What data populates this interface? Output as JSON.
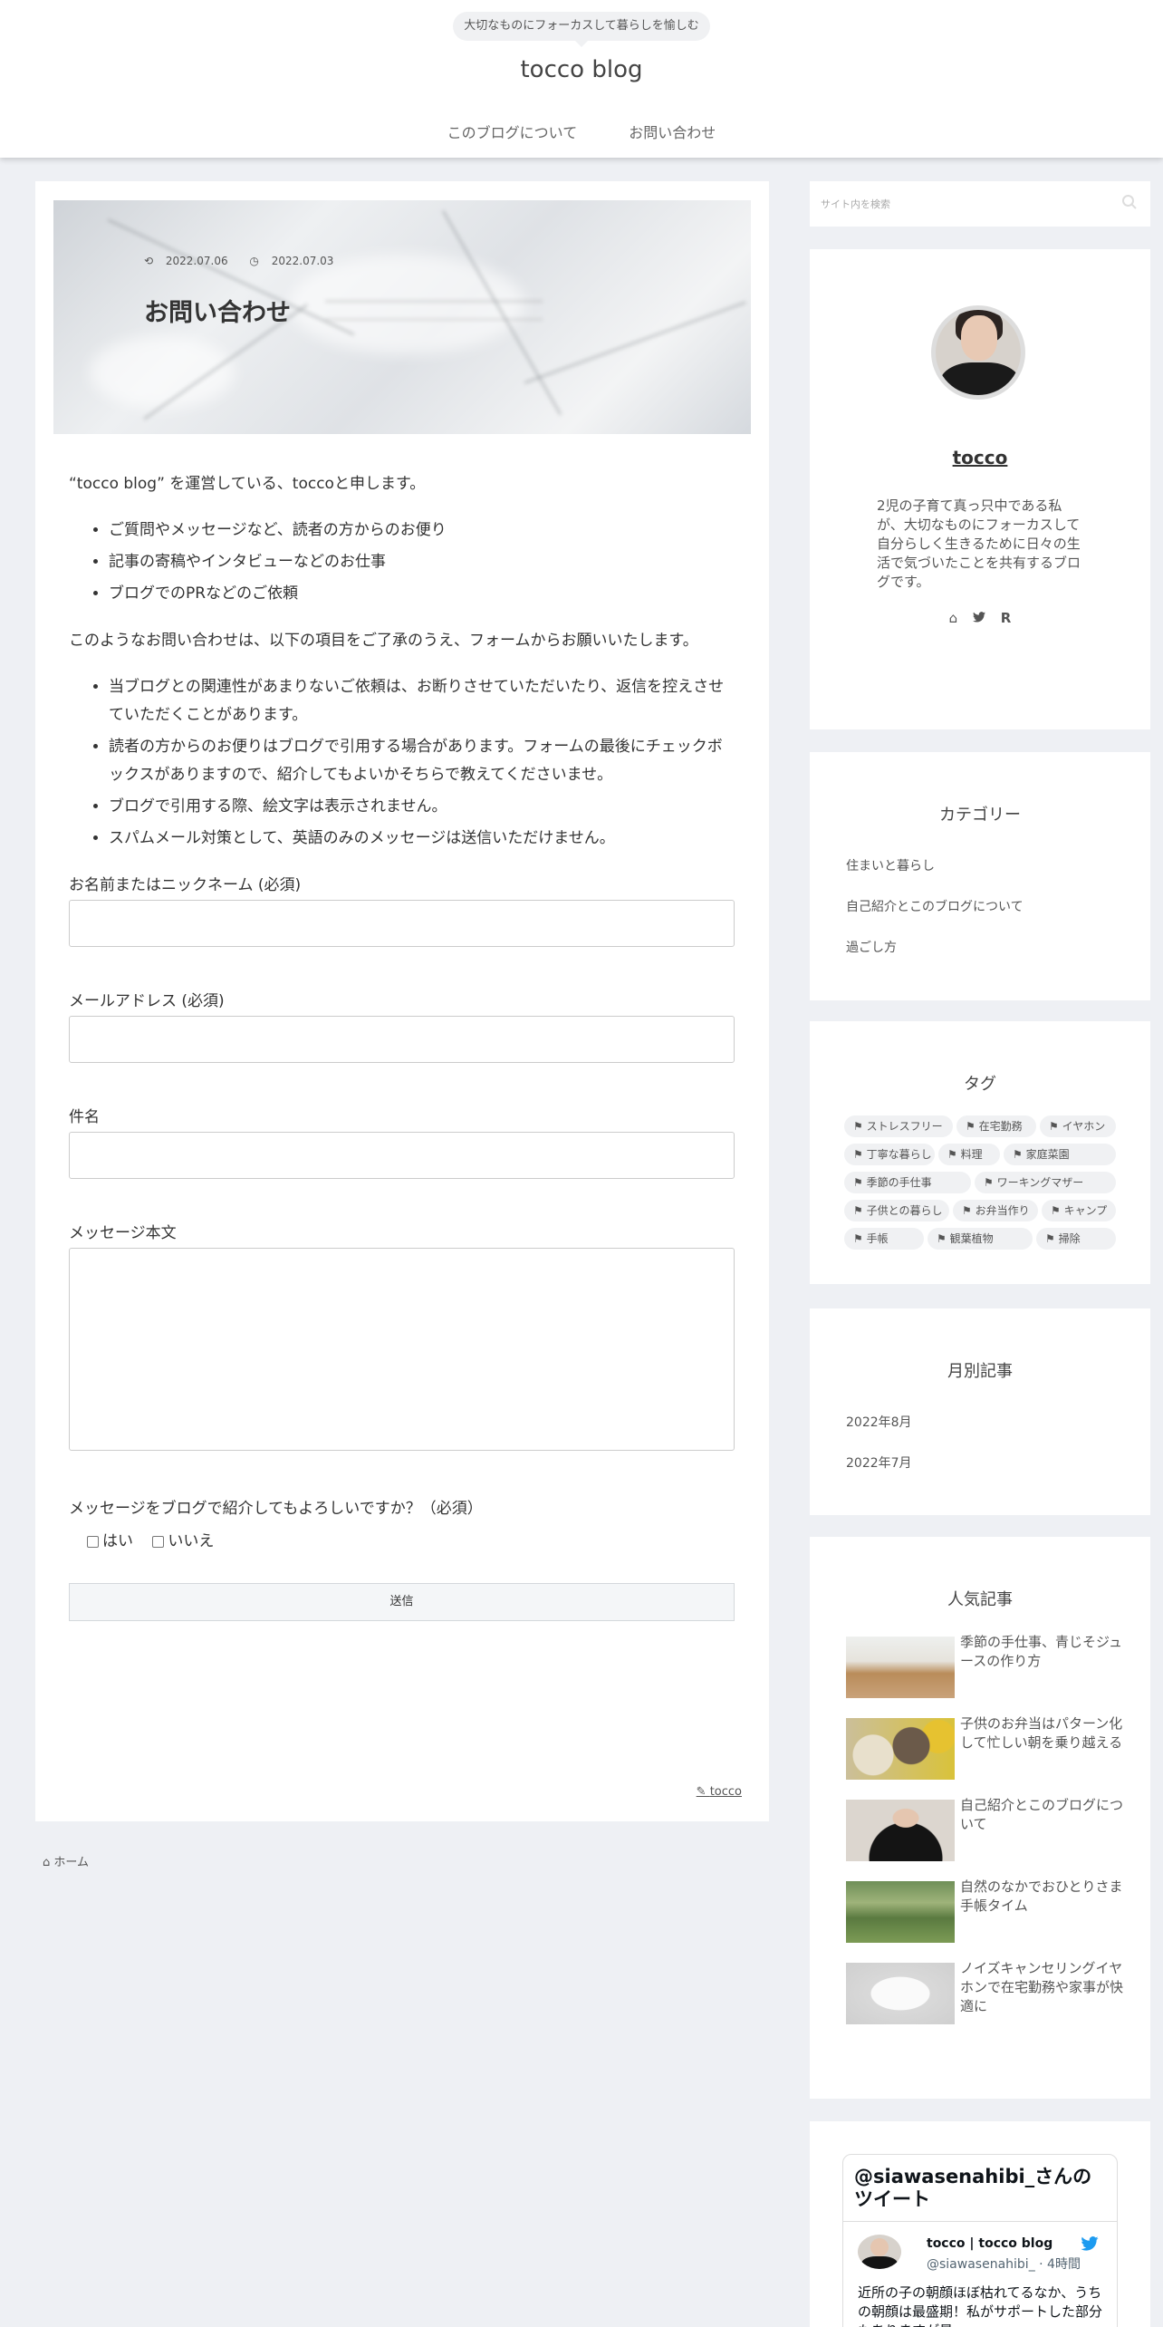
{
  "header": {
    "tagline": "大切なものにフォーカスして暮らしを愉しむ",
    "site_title": "tocco blog",
    "nav": [
      "このブログについて",
      "お問い合わせ"
    ]
  },
  "article": {
    "date_updated": "2022.07.06",
    "date_published": "2022.07.03",
    "title": "お問い合わせ",
    "intro": "“tocco blog” を運営している、toccoと申します。",
    "list1": [
      "ご質問やメッセージなど、読者の方からのお便り",
      "記事の寄稿やインタビューなどのお仕事",
      "ブログでのPRなどのご依頼"
    ],
    "para2": "このようなお問い合わせは、以下の項目をご了承のうえ、フォームからお願いいたします。",
    "list2": [
      "当ブログとの関連性があまりないご依頼は、お断りさせていただいたり、返信を控えさせていただくことがあります。",
      "読者の方からのお便りはブログで引用する場合があります。フォームの最後にチェックボックスがありますので、紹介してもよいかそちらで教えてくださいませ。",
      "ブログで引用する際、絵文字は表示されません。",
      "スパムメール対策として、英語のみのメッセージは送信いただけません。"
    ],
    "form": {
      "name_label": "お名前またはニックネーム (必須)",
      "email_label": "メールアドレス (必須)",
      "subject_label": "件名",
      "message_label": "メッセージ本文",
      "consent_label": "メッセージをブログで紹介してもよろしいですか？（必須）",
      "yes": "はい",
      "no": "いいえ",
      "submit": "送信"
    },
    "author": "tocco"
  },
  "breadcrumb": "ホーム",
  "sidebar": {
    "search_placeholder": "サイト内を検索",
    "profile": {
      "name": "tocco",
      "description": "2児の子育て真っ只中である私が、大切なものにフォーカスして自分らしく生きるために日々の生活で気づいたことを共有するブログです。"
    },
    "categories": {
      "title": "カテゴリー",
      "items": [
        "住まいと暮らし",
        "自己紹介とこのブログについて",
        "過ごし方"
      ]
    },
    "tags": {
      "title": "タグ",
      "items": [
        "ストレスフリー",
        "在宅勤務",
        "イヤホン",
        "丁寧な暮らし",
        "料理",
        "家庭菜園",
        "季節の手仕事",
        "ワーキングマザー",
        "子供との暮らし",
        "お弁当作り",
        "キャンプ",
        "手帳",
        "観葉植物",
        "掃除"
      ]
    },
    "archives": {
      "title": "月別記事",
      "items": [
        "2022年8月",
        "2022年7月"
      ]
    },
    "popular": {
      "title": "人気記事",
      "items": [
        "季節の手仕事、青じそジュースの作り方",
        "子供のお弁当はパターン化して忙しい朝を乗り越える",
        "自己紹介とこのブログについて",
        "自然のなかでおひとりさま手帳タイム",
        "ノイズキャンセリングイヤホンで在宅勤務や家事が快適に"
      ]
    },
    "twitter": {
      "header": "@siawasenahibi_さんのツイート",
      "name": "tocco | tocco blog",
      "handle": "@siawasenahibi_ · 4時間",
      "text": "近所の子の朝顔ほぼ枯れてるなか、うちの朝顔は最盛期！私がサポートした部分もありますが最"
    }
  },
  "colors": {
    "background": "#eef0f4",
    "card": "#ffffff",
    "tag_bg": "#f0f1f3",
    "twitter_blue": "#1d9bf0"
  }
}
